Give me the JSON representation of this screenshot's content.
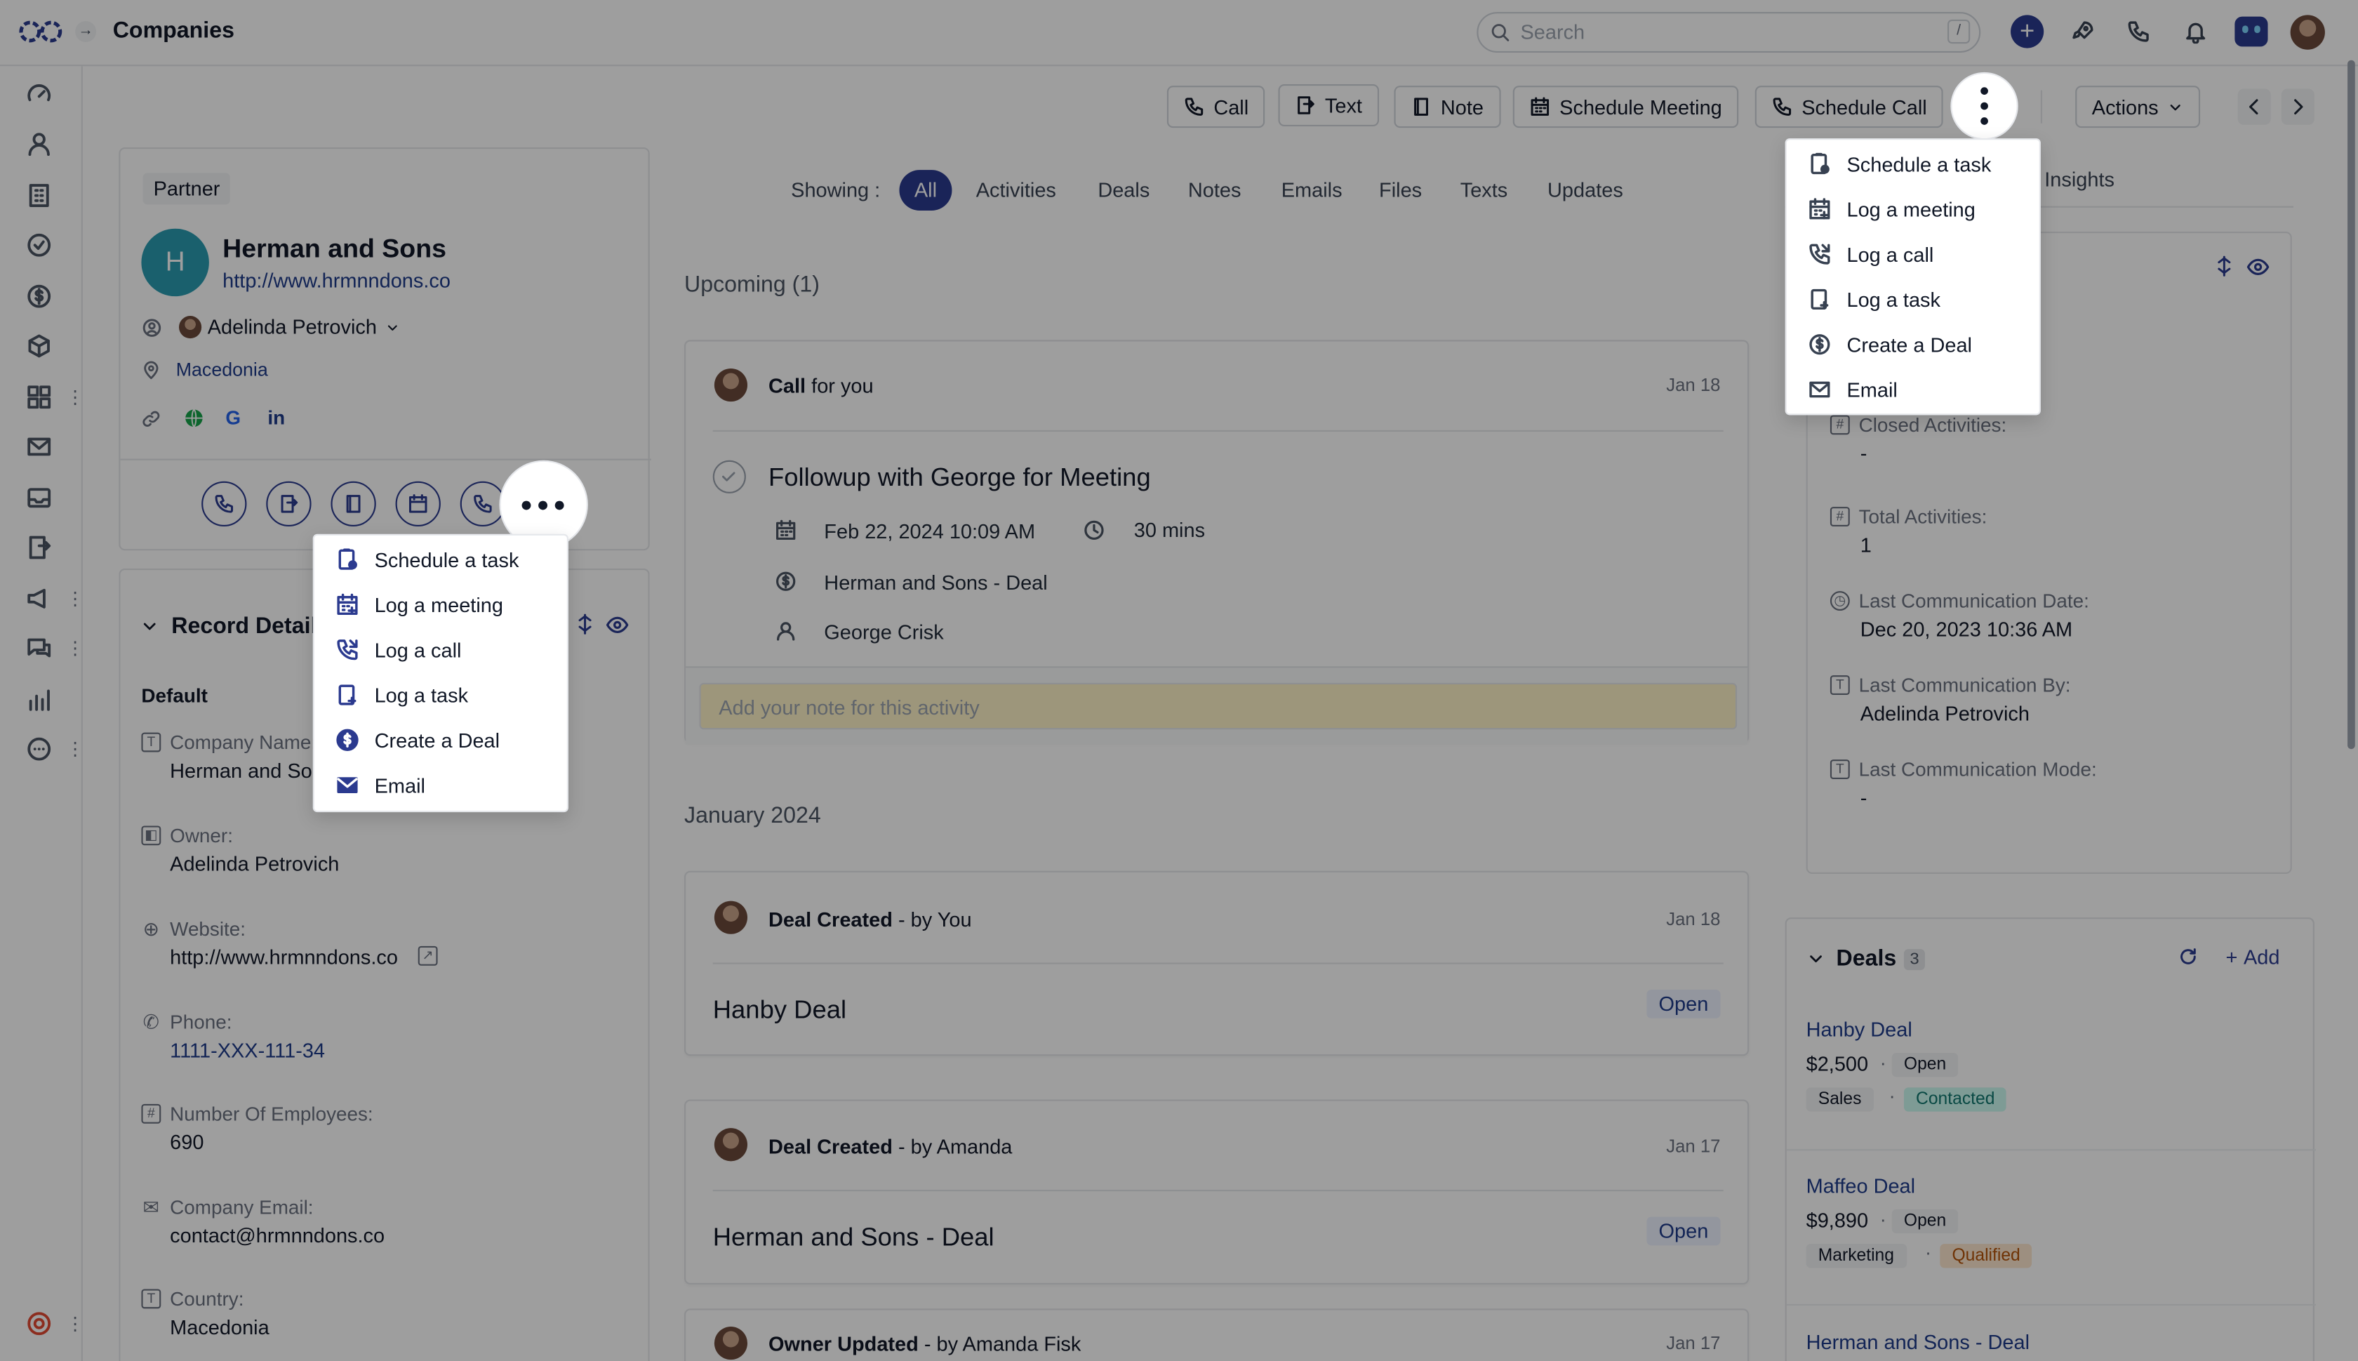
{
  "header": {
    "title": "Companies",
    "search_placeholder": "Search",
    "search_shortcut": "/"
  },
  "toolbar": {
    "call": "Call",
    "text": "Text",
    "note": "Note",
    "schedule_meeting": "Schedule Meeting",
    "schedule_call": "Schedule Call",
    "actions": "Actions"
  },
  "company": {
    "type_badge": "Partner",
    "avatar_letter": "H",
    "name": "Herman and Sons",
    "website": "http://www.hrmnndons.co",
    "owner": "Adelinda Petrovich",
    "location": "Macedonia"
  },
  "record_details": {
    "title": "Record Details",
    "section": "Default",
    "fields": [
      {
        "label": "Company Name:",
        "value": "Herman and Sons"
      },
      {
        "label": "Owner:",
        "value": "Adelinda Petrovich"
      },
      {
        "label": "Website:",
        "value": "http://www.hrmnndons.co"
      },
      {
        "label": "Phone:",
        "value": "1111-XXX-111-34"
      },
      {
        "label": "Number Of Employees:",
        "value": "690"
      },
      {
        "label": "Company Email:",
        "value": "contact@hrmnndons.co"
      },
      {
        "label": "Country:",
        "value": "Macedonia"
      }
    ]
  },
  "quick_menu": {
    "items": [
      "Schedule a task",
      "Log a meeting",
      "Log a call",
      "Log a task",
      "Create a Deal",
      "Email"
    ]
  },
  "actions_menu": {
    "items": [
      "Schedule a task",
      "Log a meeting",
      "Log a call",
      "Log a task",
      "Create a Deal",
      "Email"
    ]
  },
  "timeline": {
    "showing_label": "Showing :",
    "filters": [
      "All",
      "Activities",
      "Deals",
      "Notes",
      "Emails",
      "Files",
      "Texts",
      "Updates"
    ],
    "upcoming_heading": "Upcoming (1)",
    "upcoming": {
      "title_bold": "Call",
      "title_rest": "for you",
      "date": "Jan 18",
      "subject": "Followup with George for Meeting",
      "datetime": "Feb 22, 2024 10:09 AM",
      "duration": "30 mins",
      "deal": "Herman and Sons - Deal",
      "person": "George Crisk",
      "note_placeholder": "Add your note for this activity"
    },
    "month_heading": "January 2024",
    "entries": [
      {
        "title_bold": "Deal Created",
        "title_rest": "- by You",
        "date": "Jan 18",
        "name": "Hanby Deal",
        "status": "Open"
      },
      {
        "title_bold": "Deal Created",
        "title_rest": "- by Amanda",
        "date": "Jan 17",
        "name": "Herman and Sons - Deal",
        "status": "Open"
      },
      {
        "title_bold": "Owner Updated",
        "title_rest": "- by Amanda Fisk",
        "date": "Jan 17"
      }
    ]
  },
  "insights": {
    "tab_partial": "s Insights",
    "stats": [
      {
        "label": "Closed Activities:",
        "value": "-"
      },
      {
        "label": "Total Activities:",
        "value": "1"
      },
      {
        "label": "Last Communication Date:",
        "value": "Dec 20, 2023 10:36 AM"
      },
      {
        "label": "Last Communication By:",
        "value": "Adelinda Petrovich"
      },
      {
        "label": "Last Communication Mode:",
        "value": "-"
      }
    ]
  },
  "deals": {
    "title": "Deals",
    "count": "3",
    "add_label": "Add",
    "items": [
      {
        "name": "Hanby Deal",
        "amount": "$2,500",
        "status": "Open",
        "pipeline": "Sales",
        "stage": "Contacted"
      },
      {
        "name": "Maffeo Deal",
        "amount": "$9,890",
        "status": "Open",
        "pipeline": "Marketing",
        "stage": "Qualified"
      },
      {
        "name": "Herman and Sons - Deal"
      }
    ]
  },
  "colors": {
    "accent": "#2b3a8f",
    "link": "#1e3a8a",
    "teal": "#2a9bb0"
  }
}
